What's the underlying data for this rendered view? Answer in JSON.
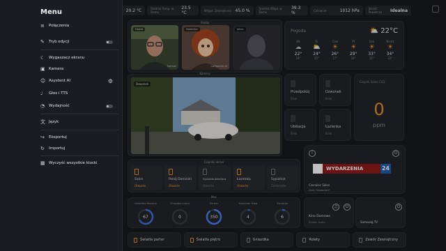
{
  "menu": {
    "title": "Menu",
    "items": [
      {
        "icon": "wifi-icon",
        "glyph": "≡",
        "label": "Połączenia"
      },
      {
        "icon": "edit-icon",
        "glyph": "✎",
        "label": "Tryb edycji",
        "toggle": "off"
      },
      {
        "icon": "moon-icon",
        "glyph": "☾",
        "label": "Wygaszacz ekranu"
      },
      {
        "icon": "camera-icon",
        "glyph": "▣",
        "label": "Kamera"
      },
      {
        "icon": "assistant-icon",
        "glyph": "☺",
        "label": "Asystent AI",
        "gear": true
      },
      {
        "icon": "voice-icon",
        "glyph": "♩",
        "label": "Głos i TTS"
      },
      {
        "icon": "performance-icon",
        "glyph": "◔",
        "label": "Wydajność",
        "toggle": "off"
      },
      {
        "icon": "language-icon",
        "glyph": "文",
        "label": "Język"
      },
      {
        "icon": "export-icon",
        "glyph": "↪",
        "label": "Eksportuj"
      },
      {
        "icon": "import-icon",
        "glyph": "↻",
        "label": "Importuj"
      },
      {
        "icon": "clear-cache-icon",
        "glyph": "▦",
        "label": "Wyczyść wszystkie klocki"
      }
    ]
  },
  "status": [
    {
      "label": "",
      "value": "20.2 °C"
    },
    {
      "label": "Średnia Temp. w Domu",
      "value": "23.5 °C"
    },
    {
      "label": "Wilgot. Zewnętrzna",
      "value": "45.0 %"
    },
    {
      "label": "Średnia Wilgo. w Domu",
      "value": "39.3 %"
    },
    {
      "label": "Ciśnienie",
      "value": "1012 hPa"
    },
    {
      "label": "Jakość Powietrza",
      "value": "Idealna"
    }
  ],
  "cameras": {
    "title": "Osoby",
    "items": [
      {
        "tag": "Dawid",
        "caption": "Samuel"
      },
      {
        "tag": "Dominika",
        "caption": "Cartoonish AI"
      },
      {
        "tag": "Jakub",
        "caption": ""
      }
    ]
  },
  "doorbell": {
    "title": "Kamery",
    "tag": "Dzwonek"
  },
  "weather": {
    "city": "Pogoda",
    "temp": "22°C",
    "days": [
      {
        "d": "Wt",
        "icon": "cloud-icon",
        "glyph": "☁",
        "t": "22°",
        "l": "18°"
      },
      {
        "d": "Śr",
        "icon": "partly-cloudy-icon",
        "glyph": "⛅",
        "t": "24°",
        "l": "15°"
      },
      {
        "d": "Czw",
        "icon": "sun-icon",
        "glyph": "☀",
        "t": "26°",
        "l": "17°"
      },
      {
        "d": "Pt",
        "icon": "sun-icon",
        "glyph": "☀",
        "t": "29°",
        "l": "18°"
      },
      {
        "d": "Sob",
        "icon": "sun-icon",
        "glyph": "☀",
        "t": "33°",
        "l": "21°"
      },
      {
        "d": "Niedz",
        "icon": "sun-icon",
        "glyph": "☀",
        "t": "34°",
        "l": "22°"
      }
    ]
  },
  "sensors": [
    {
      "name": "Przedpokój",
      "state": "Brak"
    },
    {
      "name": "Dzwonek",
      "state": "Brak"
    },
    {
      "name": "Ubikacja",
      "state": "Brak"
    },
    {
      "name": "Łazienka",
      "state": "Brak"
    }
  ],
  "co2": {
    "label": "Czujnik Salon CO2",
    "value": "0",
    "unit": "ppm"
  },
  "news": {
    "brand": "WYDARZENIA",
    "num": "24",
    "source": "Czerwiec Salon",
    "subtitle": "Dość \"Wydarzeń\""
  },
  "lights": {
    "title": "Czujniki ekran",
    "items": [
      {
        "name": "Salon",
        "state": "Otwarte",
        "on": true
      },
      {
        "name": "Pokój Dominiki",
        "state": "Otwarte",
        "on": true
      },
      {
        "name": "Sypialnia dziecięca",
        "state": "Otwarte",
        "on": false
      },
      {
        "name": "Łazienka",
        "state": "Otwarte",
        "on": true
      },
      {
        "name": "Sypialnia",
        "state": "Zamknięte",
        "on": false
      }
    ]
  },
  "gauges": {
    "title": "Moc",
    "items": [
      {
        "label": "Gniazdko Narożne",
        "value": "67",
        "frac": 0.67,
        "color": "#3f6fe0"
      },
      {
        "label": "Gniazdko Lustro",
        "value": "0",
        "frac": 0.0,
        "color": "#3f6fe0"
      },
      {
        "label": "Serwer",
        "value": "350",
        "frac": 0.9,
        "color": "#4a7ff5"
      },
      {
        "label": "Komputer Kuba",
        "value": "4",
        "frac": 0.04,
        "color": "#3f6fe0"
      },
      {
        "label": "Szczotka",
        "value": "6",
        "frac": 0.06,
        "color": "#3f6fe0"
      }
    ]
  },
  "media": {
    "kino": {
      "name": "Kino Domowe",
      "state": "Źródło: Audio"
    },
    "samsung": {
      "name": "Samsung TV"
    }
  },
  "bottom": [
    {
      "label": "Światła parter",
      "color": "orange"
    },
    {
      "label": "Światła piętro",
      "color": "orange"
    },
    {
      "label": "Gniazdka",
      "color": "grey"
    },
    {
      "label": "Rolety",
      "color": "grey"
    },
    {
      "label": "Zawór Zewnętrzny",
      "color": "grey"
    }
  ],
  "colors": {
    "accent": "#e8902a",
    "gauge": "#3f6fe0",
    "news_red": "#8f1a1a",
    "news_blue": "#1d5fb0"
  }
}
